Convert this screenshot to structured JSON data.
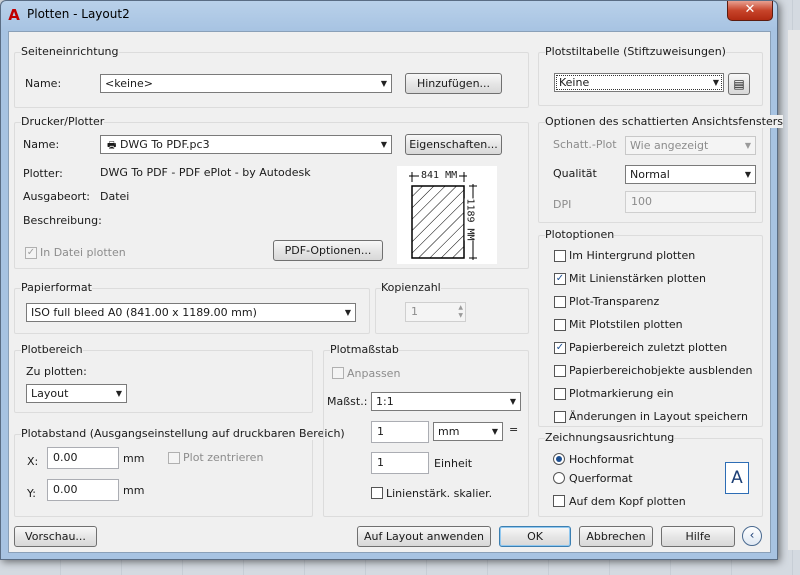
{
  "window": {
    "title": "Plotten - Layout2",
    "close": "✕"
  },
  "page_setup": {
    "title": "Seiteneinrichtung",
    "name_label": "Name:",
    "name_value": "<keine>",
    "add_button": "Hinzufügen..."
  },
  "printer": {
    "title": "Drucker/Plotter",
    "name_label": "Name:",
    "name_value": "DWG To PDF.pc3",
    "properties_button": "Eigenschaften...",
    "plotter_label": "Plotter:",
    "plotter_value": "DWG To PDF - PDF ePlot - by Autodesk",
    "location_label": "Ausgabeort:",
    "location_value": "Datei",
    "description_label": "Beschreibung:",
    "plot_to_file": "In Datei plotten",
    "pdf_options_button": "PDF-Optionen...",
    "preview_width": "841 MM",
    "preview_height": "1189 MM"
  },
  "paper_size": {
    "title": "Papierformat",
    "value": "ISO full bleed A0 (841.00 x 1189.00 mm)"
  },
  "copies": {
    "title": "Kopienzahl",
    "value": "1"
  },
  "plot_area": {
    "title": "Plotbereich",
    "what_label": "Zu plotten:",
    "what_value": "Layout"
  },
  "plot_offset": {
    "title": "Plotabstand (Ausgangseinstellung auf druckbaren Bereich)",
    "x_label": "X:",
    "x_value": "0.00",
    "x_unit": "mm",
    "y_label": "Y:",
    "y_value": "0.00",
    "y_unit": "mm",
    "center": "Plot zentrieren"
  },
  "plot_scale": {
    "title": "Plotmaßstab",
    "fit": "Anpassen",
    "scale_label": "Maßst.:",
    "scale_value": "1:1",
    "value1": "1",
    "unit1": "mm",
    "equals": "=",
    "value2": "1",
    "unit2": "Einheit",
    "scale_lineweights": "Linienstärk. skalier."
  },
  "plot_style_table": {
    "title": "Plotstiltabelle (Stiftzuweisungen)",
    "value": "Keine"
  },
  "shaded_viewport": {
    "title": "Optionen des schattierten Ansichtsfensters",
    "shade_label": "Schatt.-Plot",
    "shade_value": "Wie angezeigt",
    "quality_label": "Qualität",
    "quality_value": "Normal",
    "dpi_label": "DPI",
    "dpi_value": "100"
  },
  "plot_options": {
    "title": "Plotoptionen",
    "items": [
      {
        "label": "Im Hintergrund plotten",
        "checked": false
      },
      {
        "label": "Mit Linienstärken plotten",
        "checked": true
      },
      {
        "label": "Plot-Transparenz",
        "checked": false
      },
      {
        "label": "Mit Plotstilen plotten",
        "checked": false
      },
      {
        "label": "Papierbereich zuletzt plotten",
        "checked": true
      },
      {
        "label": "Papierbereichobjekte ausblenden",
        "checked": false
      },
      {
        "label": "Plotmarkierung ein",
        "checked": false
      },
      {
        "label": "Änderungen in Layout speichern",
        "checked": false
      }
    ]
  },
  "orientation": {
    "title": "Zeichnungsausrichtung",
    "portrait": "Hochformat",
    "landscape": "Querformat",
    "upside_down": "Auf dem Kopf plotten",
    "icon_letter": "A"
  },
  "footer": {
    "preview": "Vorschau...",
    "apply": "Auf Layout anwenden",
    "ok": "OK",
    "cancel": "Abbrechen",
    "help": "Hilfe"
  }
}
